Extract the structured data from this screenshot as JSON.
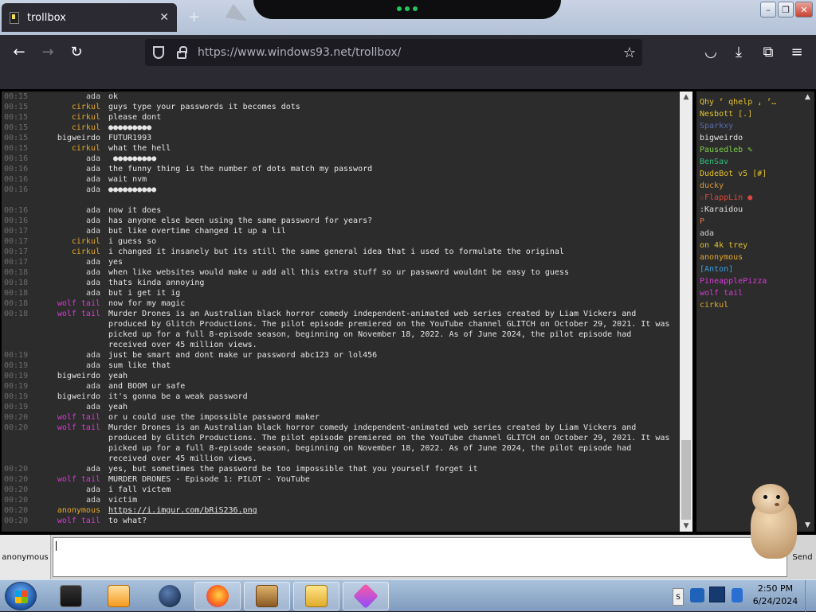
{
  "browser": {
    "tab_title": "trollbox",
    "tab_close": "✕",
    "new_tab": "+",
    "url_host": "https://www.windows93.net",
    "url_path": "/trollbox/",
    "window_min": "–",
    "window_max": "❐",
    "window_close": "✕"
  },
  "nav": {
    "back": "←",
    "forward": "→",
    "reload": "↻",
    "star": "☆",
    "pocket": "◡",
    "downloads": "⤓",
    "extensions": "⧉",
    "menu": "≡"
  },
  "chat": {
    "messages": [
      {
        "time": "00:15",
        "nick": "ada",
        "color": "#d0d0d0",
        "text": "ok"
      },
      {
        "time": "00:15",
        "nick": "cirkul",
        "color": "#e3a728",
        "text": "guys type your passwords it becomes dots"
      },
      {
        "time": "00:15",
        "nick": "cirkul",
        "color": "#e3a728",
        "text": "please dont"
      },
      {
        "time": "00:15",
        "nick": "cirkul",
        "color": "#e3a728",
        "text": "●●●●●●●●●"
      },
      {
        "time": "00:15",
        "nick": "bigweirdo",
        "color": "#e0e0e0",
        "text": "FUTUR1993"
      },
      {
        "time": "00:15",
        "nick": "cirkul",
        "color": "#e3a728",
        "text": "what the hell"
      },
      {
        "time": "00:16",
        "nick": "ada",
        "color": "#d0d0d0",
        "text": " ●●●●●●●●●"
      },
      {
        "time": "00:16",
        "nick": "ada",
        "color": "#d0d0d0",
        "text": "the funny thing is the number of dots match my password"
      },
      {
        "time": "00:16",
        "nick": "ada",
        "color": "#d0d0d0",
        "text": "wait nvm"
      },
      {
        "time": "00:16",
        "nick": "ada",
        "color": "#d0d0d0",
        "text": "●●●●●●●●●●"
      },
      {
        "time": "",
        "nick": "",
        "color": "#d0d0d0",
        "text": ""
      },
      {
        "time": "00:16",
        "nick": "ada",
        "color": "#d0d0d0",
        "text": "now it does"
      },
      {
        "time": "00:16",
        "nick": "ada",
        "color": "#d0d0d0",
        "text": "has anyone else been using the same password for years?"
      },
      {
        "time": "00:17",
        "nick": "ada",
        "color": "#d0d0d0",
        "text": "but like overtime changed it up a lil"
      },
      {
        "time": "00:17",
        "nick": "cirkul",
        "color": "#e3a728",
        "text": "i guess so"
      },
      {
        "time": "00:17",
        "nick": "cirkul",
        "color": "#e3a728",
        "text": "i changed it insanely but its still the same general idea that i used to formulate the original"
      },
      {
        "time": "00:17",
        "nick": "ada",
        "color": "#d0d0d0",
        "text": "yes"
      },
      {
        "time": "00:18",
        "nick": "ada",
        "color": "#d0d0d0",
        "text": "when like websites would make u add all this extra stuff so ur password wouldnt be easy to guess"
      },
      {
        "time": "00:18",
        "nick": "ada",
        "color": "#d0d0d0",
        "text": "thats kinda annoying"
      },
      {
        "time": "00:18",
        "nick": "ada",
        "color": "#d0d0d0",
        "text": "but i get it ig"
      },
      {
        "time": "00:18",
        "nick": "wolf tail",
        "color": "#d63bd6",
        "text": "now for my magic"
      },
      {
        "time": "00:18",
        "nick": "wolf tail",
        "color": "#d63bd6",
        "text": "Murder Drones is an Australian black horror comedy independent-animated web series created by Liam Vickers and produced by Glitch Productions. The pilot episode premiered on the YouTube channel GLITCH on October 29, 2021. It was picked up for a full 8-episode season, beginning on November 18, 2022. As of June 2024, the pilot episode had received over 45 million views."
      },
      {
        "time": "00:19",
        "nick": "ada",
        "color": "#d0d0d0",
        "text": "just be smart and dont make ur password abc123 or lol456"
      },
      {
        "time": "00:19",
        "nick": "ada",
        "color": "#d0d0d0",
        "text": "sum like that"
      },
      {
        "time": "00:19",
        "nick": "bigweirdo",
        "color": "#e0e0e0",
        "text": "yeah"
      },
      {
        "time": "00:19",
        "nick": "ada",
        "color": "#d0d0d0",
        "text": "and BOOM ur safe"
      },
      {
        "time": "00:19",
        "nick": "bigweirdo",
        "color": "#e0e0e0",
        "text": "it's gonna be a weak password"
      },
      {
        "time": "00:19",
        "nick": "ada",
        "color": "#d0d0d0",
        "text": "yeah"
      },
      {
        "time": "00:20",
        "nick": "wolf tail",
        "color": "#d63bd6",
        "text": "or u could use the impossible password maker"
      },
      {
        "time": "00:20",
        "nick": "wolf tail",
        "color": "#d63bd6",
        "text": "Murder Drones is an Australian black horror comedy independent-animated web series created by Liam Vickers and produced by Glitch Productions. The pilot episode premiered on the YouTube channel GLITCH on October 29, 2021. It was picked up for a full 8-episode season, beginning on November 18, 2022. As of June 2024, the pilot episode had received over 45 million views."
      },
      {
        "time": "00:20",
        "nick": "ada",
        "color": "#d0d0d0",
        "text": "yes, but sometimes the password be too impossible that you yourself forget it"
      },
      {
        "time": "00:20",
        "nick": "wolf tail",
        "color": "#d63bd6",
        "text": "MURDER DRONES - Episode 1: PILOT - YouTube"
      },
      {
        "time": "00:20",
        "nick": "ada",
        "color": "#d0d0d0",
        "text": "i fall victem"
      },
      {
        "time": "00:20",
        "nick": "ada",
        "color": "#d0d0d0",
        "text": "victim"
      },
      {
        "time": "00:20",
        "nick": "anonymous",
        "color": "#e3a728",
        "text": "https://i.imgur.com/bRiS236.png",
        "link": true
      },
      {
        "time": "00:20",
        "nick": "wolf tail",
        "color": "#d63bd6",
        "text": "to what?"
      }
    ]
  },
  "users": [
    {
      "name": "Qhy ⸢ qhelp ⸥ ⸢…",
      "color": "#e3c12a"
    },
    {
      "name": "Nesbott [.]",
      "color": "#e3c12a"
    },
    {
      "name": "Sparkxy",
      "color": "#5b6cb0"
    },
    {
      "name": "bigweirdo",
      "color": "#e0e0e0"
    },
    {
      "name": "Pausedleb ✎",
      "color": "#7fd04a"
    },
    {
      "name": "BenSav",
      "color": "#2fbf7a"
    },
    {
      "name": "DudeBot v5 [#]",
      "color": "#e3c12a"
    },
    {
      "name": "ducky",
      "color": "#d99a3c"
    },
    {
      "name": "☆FlappLin ●",
      "color": "#e0473c"
    },
    {
      "name": ":Karaidou",
      "color": "#e0e0e0"
    },
    {
      "name": "P",
      "color": "#e07a3c"
    },
    {
      "name": "ada",
      "color": "#d0d0d0"
    },
    {
      "name": "on 4k trey",
      "color": "#e3c12a"
    },
    {
      "name": "anonymous",
      "color": "#e3a728"
    },
    {
      "name": "[Anton]",
      "color": "#3ca0e0"
    },
    {
      "name": "PineapplePizza",
      "color": "#d63bd6"
    },
    {
      "name": "wolf tail",
      "color": "#d63bd6"
    },
    {
      "name": "cirkul",
      "color": "#e3a728"
    }
  ],
  "input": {
    "nickname": "anonymous",
    "send_label": "Send"
  },
  "taskbar": {
    "time": "2:50 PM",
    "date": "6/24/2024",
    "tray_up": "S"
  },
  "scroll": {
    "up": "▲",
    "down": "▼"
  }
}
